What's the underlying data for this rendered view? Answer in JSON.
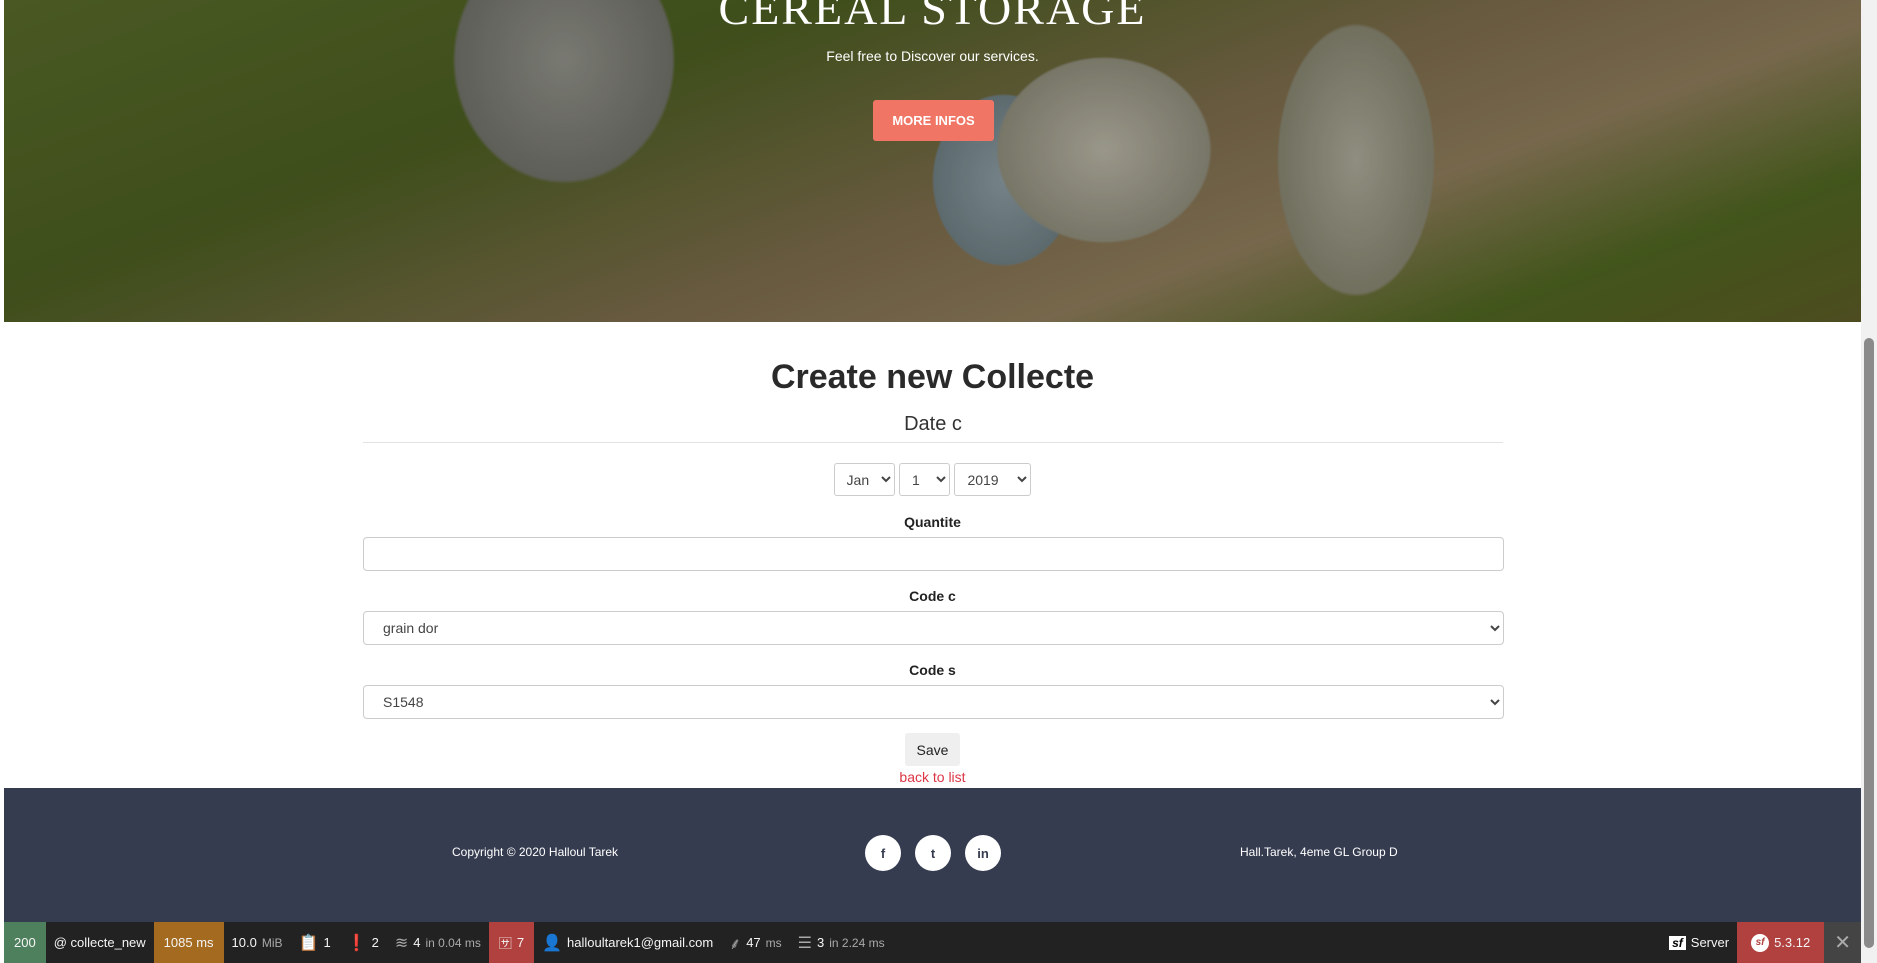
{
  "hero": {
    "title": "CEREAL STORAGE",
    "subtitle": "Feel free to Discover our services.",
    "button": "MORE INFOS"
  },
  "form": {
    "title": "Create new Collecte",
    "date_legend": "Date c",
    "month": "Jan",
    "day": "1",
    "year": "2019",
    "quantite_label": "Quantite",
    "quantite_value": "",
    "code_c_label": "Code c",
    "code_c_value": "grain dor",
    "code_s_label": "Code s",
    "code_s_value": "S1548",
    "save": "Save",
    "back": "back to list"
  },
  "footer": {
    "copyright": "Copyright © 2020 Halloul Tarek",
    "facebook": "f",
    "twitter": "t",
    "linkedin": "in",
    "address": "Hall.Tarek, 4eme GL Group D"
  },
  "toolbar": {
    "status": "200",
    "route": "@ collecte_new",
    "time": "1085 ms",
    "memory": "10.0",
    "memory_unit": "MiB",
    "forms": "1",
    "exceptions": "2",
    "cache": "4",
    "cache_suffix": "in 0.04 ms",
    "translations": "7",
    "user": "halloultarek1@gmail.com",
    "twig": "47",
    "twig_unit": "ms",
    "db": "3",
    "db_suffix": "in 2.24 ms",
    "server": "Server",
    "version": "5.3.12",
    "close": "✕",
    "colors": {
      "status": "#4f805d",
      "time": "#a46a1f",
      "translations": "#b0413e"
    }
  }
}
